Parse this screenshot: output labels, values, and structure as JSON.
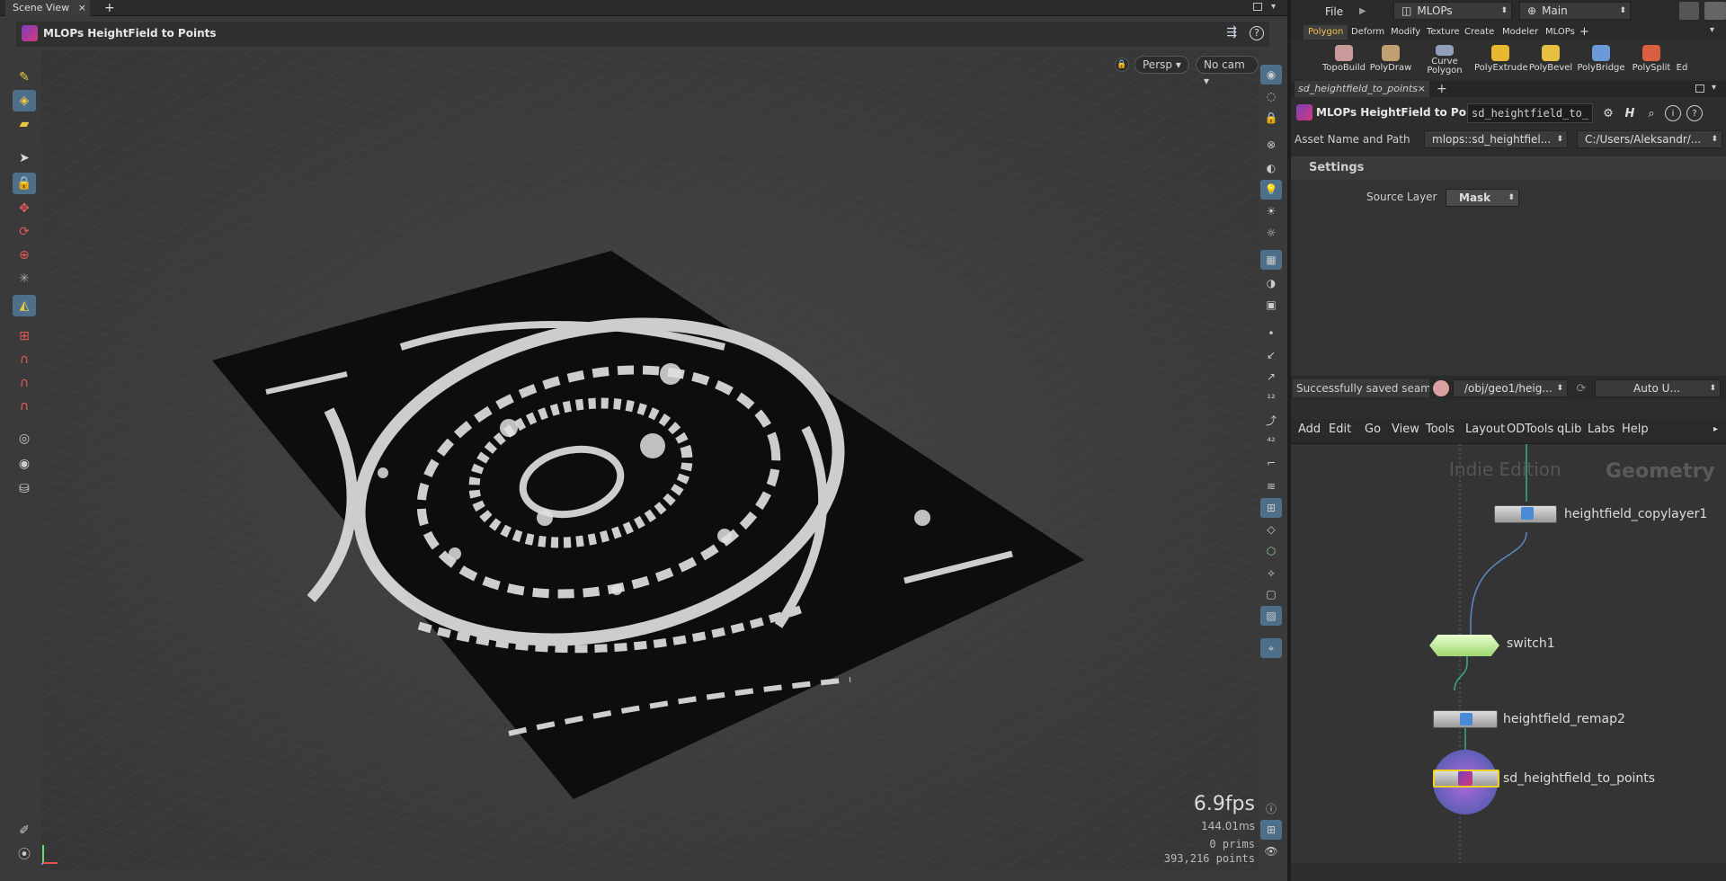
{
  "scene_tab": {
    "label": "Scene View",
    "close": "×",
    "add": "+"
  },
  "viewer": {
    "title": "MLOPs HeightField to Points",
    "persp": "Persp",
    "cam": "No cam",
    "fps": "6.9fps",
    "ms": "144.01ms",
    "prims": "0  prims",
    "points": "393,216 points",
    "watermark": "Indie Edition"
  },
  "top": {
    "file": "File",
    "desktop": "MLOPs",
    "context": "Main"
  },
  "shelf": {
    "tabs": [
      "Polygon",
      "Deform",
      "Modify",
      "Texture",
      "Create",
      "Modeler",
      "MLOPs",
      "+"
    ],
    "tools": [
      "TopoBuild",
      "PolyDraw",
      "Curve Polygon",
      "PolyExtrude",
      "PolyBevel",
      "PolyBridge",
      "PolySplit",
      "Ed"
    ]
  },
  "params": {
    "tab_label": "sd_heightfield_to_points",
    "node_type": "MLOPs HeightField to Poi...",
    "node_name": "sd_heightfield_to_",
    "asset_label": "Asset Name and Path",
    "asset_name": "mlops::sd_heightfiel...",
    "asset_path": "C:/Users/Aleksandr/...",
    "section": "Settings",
    "source_layer_label": "Source Layer",
    "source_layer_value": "Mask"
  },
  "status": {
    "message": "Successfully saved seamlessinp...",
    "path": "/obj/geo1/heig...",
    "auto": "Auto U..."
  },
  "network_menu": [
    "Add",
    "Edit",
    "Go",
    "View",
    "Tools",
    "Layout",
    "ODTools",
    "qLib",
    "Labs",
    "Help"
  ],
  "network": {
    "watermark": "Indie Edition",
    "context_label": "Geometry",
    "nodes": [
      "heightfield_copylayer1",
      "switch1",
      "heightfield_remap2",
      "sd_heightfield_to_points"
    ]
  }
}
